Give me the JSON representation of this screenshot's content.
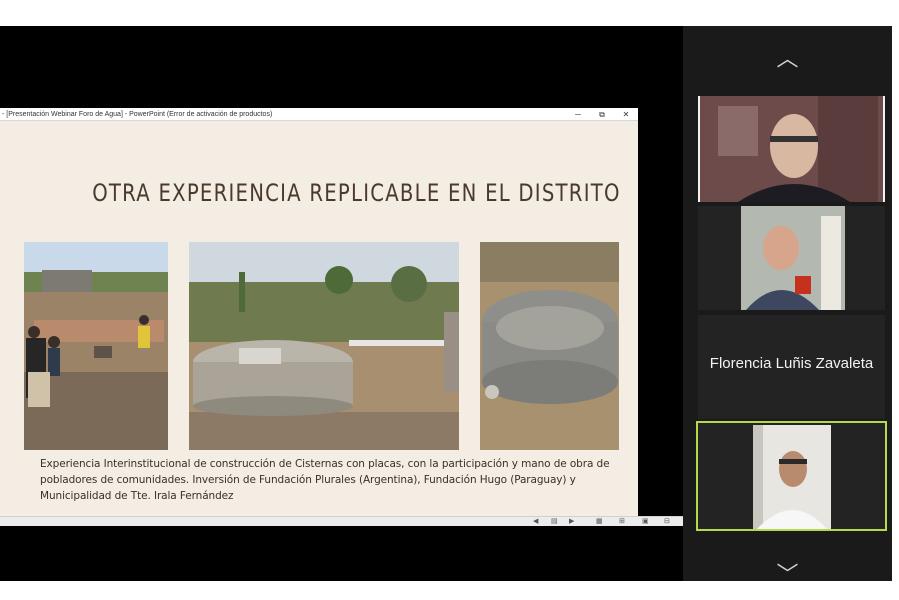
{
  "presentation": {
    "window_title": "- [Presentación Webinar Foro de Agua] - PowerPoint (Error de activación de productos)",
    "controls": {
      "minimize": "─",
      "restore": "⧉",
      "close": "✕"
    },
    "slide_title": "OTRA EXPERIENCIA REPLICABLE EN EL DISTRITO",
    "caption": "Experiencia Interinstitucional de construcción de Cisternas con placas, con la participación y mano de obra de pobladores de comunidades. Inversión de Fundación Plurales (Argentina), Fundación Hugo (Paraguay) y Municipalidad de Tte. Irala Fernández",
    "status_icons": [
      "◀",
      "▤",
      "▶",
      "▦",
      "⊞",
      "▣",
      "⊟"
    ]
  },
  "participants": {
    "nav_up": "︿",
    "nav_down": "﹀",
    "tiles": [
      {
        "type": "video"
      },
      {
        "type": "video"
      },
      {
        "type": "name",
        "name": "Florencia Luñis Zavaleta"
      },
      {
        "type": "video",
        "active_speaker": true
      }
    ]
  },
  "colors": {
    "slide_background": "#f3ede4",
    "title_text": "#4b3a2c",
    "active_speaker_border": "#b4d94a",
    "panel_background": "#1a1a1a"
  }
}
